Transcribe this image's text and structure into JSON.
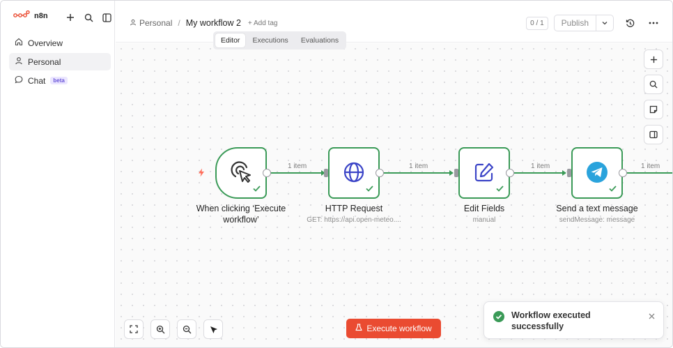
{
  "app": {
    "logo_text": "n8n",
    "accent": "#ea4b31",
    "success": "#3a9a57"
  },
  "sidebar": {
    "items": [
      {
        "label": "Overview",
        "icon": "home-icon"
      },
      {
        "label": "Personal",
        "icon": "user-icon"
      },
      {
        "label": "Chat",
        "icon": "chat-icon",
        "badge": "beta"
      }
    ]
  },
  "header": {
    "breadcrumb_project": "Personal",
    "breadcrumb_separator": "/",
    "workflow_name": "My workflow 2",
    "add_tag": "+ Add tag",
    "counter": "0 / 1",
    "publish": "Publish"
  },
  "tabs": [
    {
      "label": "Editor",
      "active": true
    },
    {
      "label": "Executions",
      "active": false
    },
    {
      "label": "Evaluations",
      "active": false
    }
  ],
  "nodes": [
    {
      "title": "When clicking ‘Execute workflow’",
      "subtitle": ""
    },
    {
      "title": "HTTP Request",
      "subtitle": "GET: https://api.open-meteo...."
    },
    {
      "title": "Edit Fields",
      "subtitle": "manual"
    },
    {
      "title": "Send a text message",
      "subtitle": "sendMessage: message"
    }
  ],
  "connections": [
    "1 item",
    "1 item",
    "1 item",
    "1 item"
  ],
  "execute_button": "Execute workflow",
  "toast": {
    "message": "Workflow executed successfully"
  }
}
